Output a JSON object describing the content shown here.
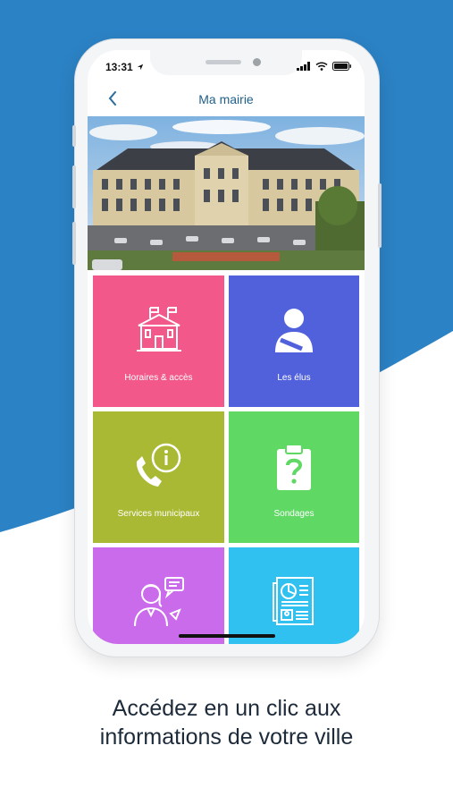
{
  "colors": {
    "background_blue": "#2b82c4",
    "tile_horaires": "#f2598a",
    "tile_elus": "#5161dc",
    "tile_services": "#aab934",
    "tile_sondages": "#5fd864",
    "tile_bottom_left": "#c96bea",
    "tile_bottom_right": "#31c1f0",
    "title_blue": "#1f5f8b"
  },
  "status_bar": {
    "time": "13:31"
  },
  "nav": {
    "title": "Ma mairie",
    "back_icon": "chevron-left-icon"
  },
  "hero": {
    "image": "town-hall-photo"
  },
  "tiles": [
    {
      "label": "Horaires & accès",
      "icon": "town-hall-icon"
    },
    {
      "label": "Les élus",
      "icon": "person-icon"
    },
    {
      "label": "Services municipaux",
      "icon": "phone-info-icon"
    },
    {
      "label": "Sondages",
      "icon": "clipboard-question-icon"
    },
    {
      "label": "",
      "icon": "speaking-person-icon"
    },
    {
      "label": "",
      "icon": "newspaper-icon"
    }
  ],
  "caption": {
    "line1": "Accédez en un clic aux",
    "line2": "informations de votre ville"
  }
}
